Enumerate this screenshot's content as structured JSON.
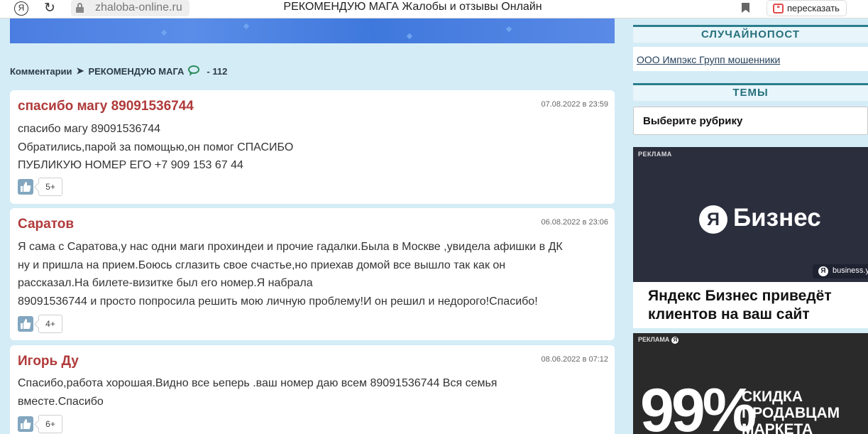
{
  "browser": {
    "ya_glyph": "Я",
    "reload_glyph": "↻",
    "url": "zhaloba-online.ru",
    "title": "РЕКОМЕНДУЮ МАГА Жалобы и отзывы Онлайн",
    "retell_label": "пересказать",
    "retell_icon_glyph": "❝"
  },
  "crumbs": {
    "comments_label": "Комментарии",
    "arrow": "➤",
    "post_title": "РЕКОМЕНДУЮ МАГА",
    "count": "- 112"
  },
  "comments": [
    {
      "name": "спасибо магу 89091536744",
      "date": "07.08.2022 в 23:59",
      "lines": [
        "спасибо магу 89091536744",
        "Обратились,парой за помощью,он помог СПАСИБО",
        "ПУБЛИКУЮ НОМЕР ЕГО +7 909 153 67 44"
      ],
      "likes": "5+"
    },
    {
      "name": "Саратов",
      "date": "06.08.2022 в 23:06",
      "lines": [
        "Я сама с Саратова,у нас одни маги прохиндеи и прочие гадалки.Была в Москве ,увидела афишки в ДК",
        "ну и пришла на прием.Боюсь сглазить свое счастье,но приехав домой все вышло так как он",
        "рассказал.На билете-визитке был его номер.Я набрала",
        "89091536744 и просто попросила решить мою личную проблему!И он решил и недорого!Спасибо!"
      ],
      "likes": "4+"
    },
    {
      "name": "Игорь Ду",
      "date": "08.06.2022 в 07:12",
      "lines": [
        "Спасибо,работа хорошая.Видно все ьеперь .ваш номер даю всем 89091536744 Вся семья",
        "вместе.Спасибо"
      ],
      "likes": "6+"
    }
  ],
  "sidebar": {
    "random_heading": "СЛУЧАЙНОПОСТ",
    "random_link": "ООО Импэкс Групп мошенники",
    "themes_heading": "ТЕМЫ",
    "rubric_select": "Выберите рубрику"
  },
  "ads": {
    "ad1": {
      "label": "РЕКЛАМА",
      "logo_glyph": "Я",
      "brand": "Бизнес",
      "domain": "business.y",
      "domain_glyph": "Я",
      "caption": "Яндекс Бизнес приведёт клиентов на ваш сайт"
    },
    "ad2": {
      "label": "РЕКЛАМА",
      "label_glyph": "Я",
      "big": "99%",
      "promo_1": "СКИДКА",
      "promo_2": "ПРОДАВЦАМ",
      "promo_3": "МАРКЕТА"
    }
  }
}
